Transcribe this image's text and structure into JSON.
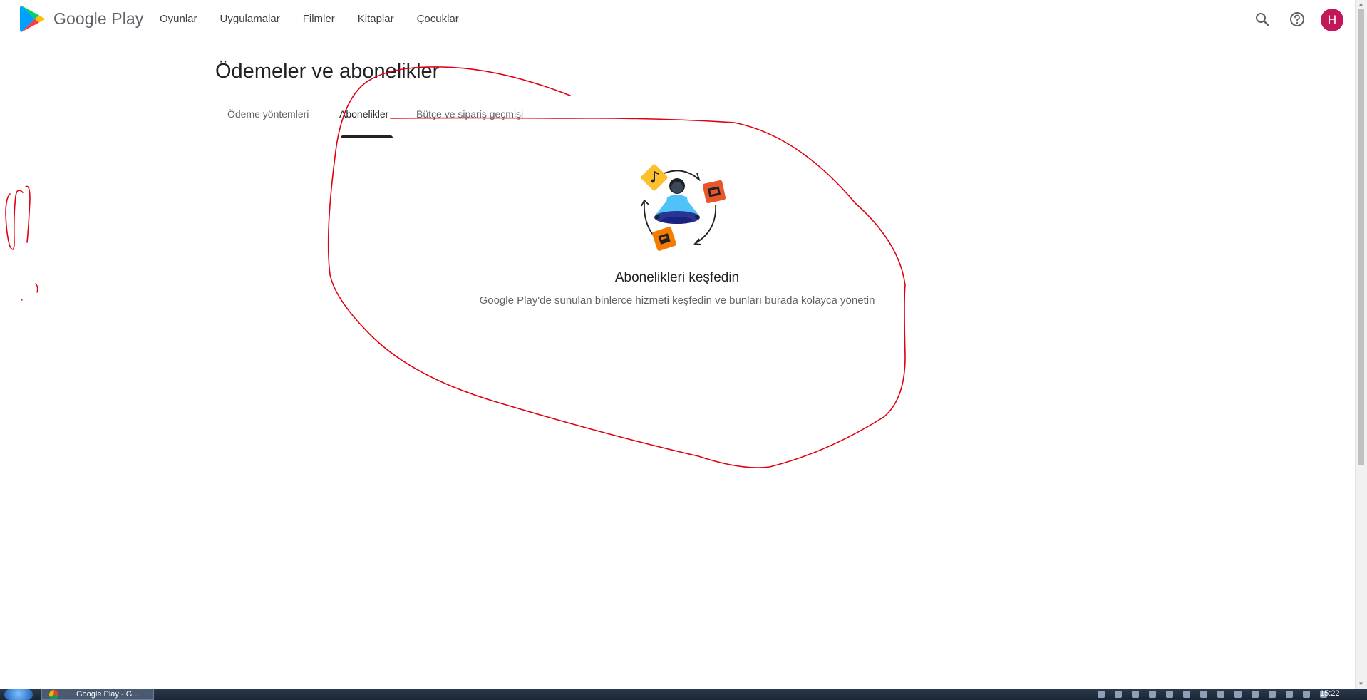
{
  "header": {
    "logo_text": "Google Play",
    "nav": [
      "Oyunlar",
      "Uygulamalar",
      "Filmler",
      "Kitaplar",
      "Çocuklar"
    ],
    "avatar_letter": "H"
  },
  "page": {
    "title": "Ödemeler ve abonelikler",
    "tabs": [
      {
        "label": "Ödeme yöntemleri",
        "active": false
      },
      {
        "label": "Abonelikler",
        "active": true
      },
      {
        "label": "Bütçe ve sipariş geçmişi",
        "active": false
      }
    ],
    "empty_state": {
      "title": "Abonelikleri keşfedin",
      "description": "Google Play'de sunulan binlerce hizmeti keşfedin ve bunları burada kolayca yönetin"
    }
  },
  "taskbar": {
    "task_label": "Google Play - G...",
    "clock": "15:22"
  },
  "colors": {
    "annotation": "#e0000f",
    "avatar": "#c2185b",
    "tab_indicator": "#202124"
  }
}
